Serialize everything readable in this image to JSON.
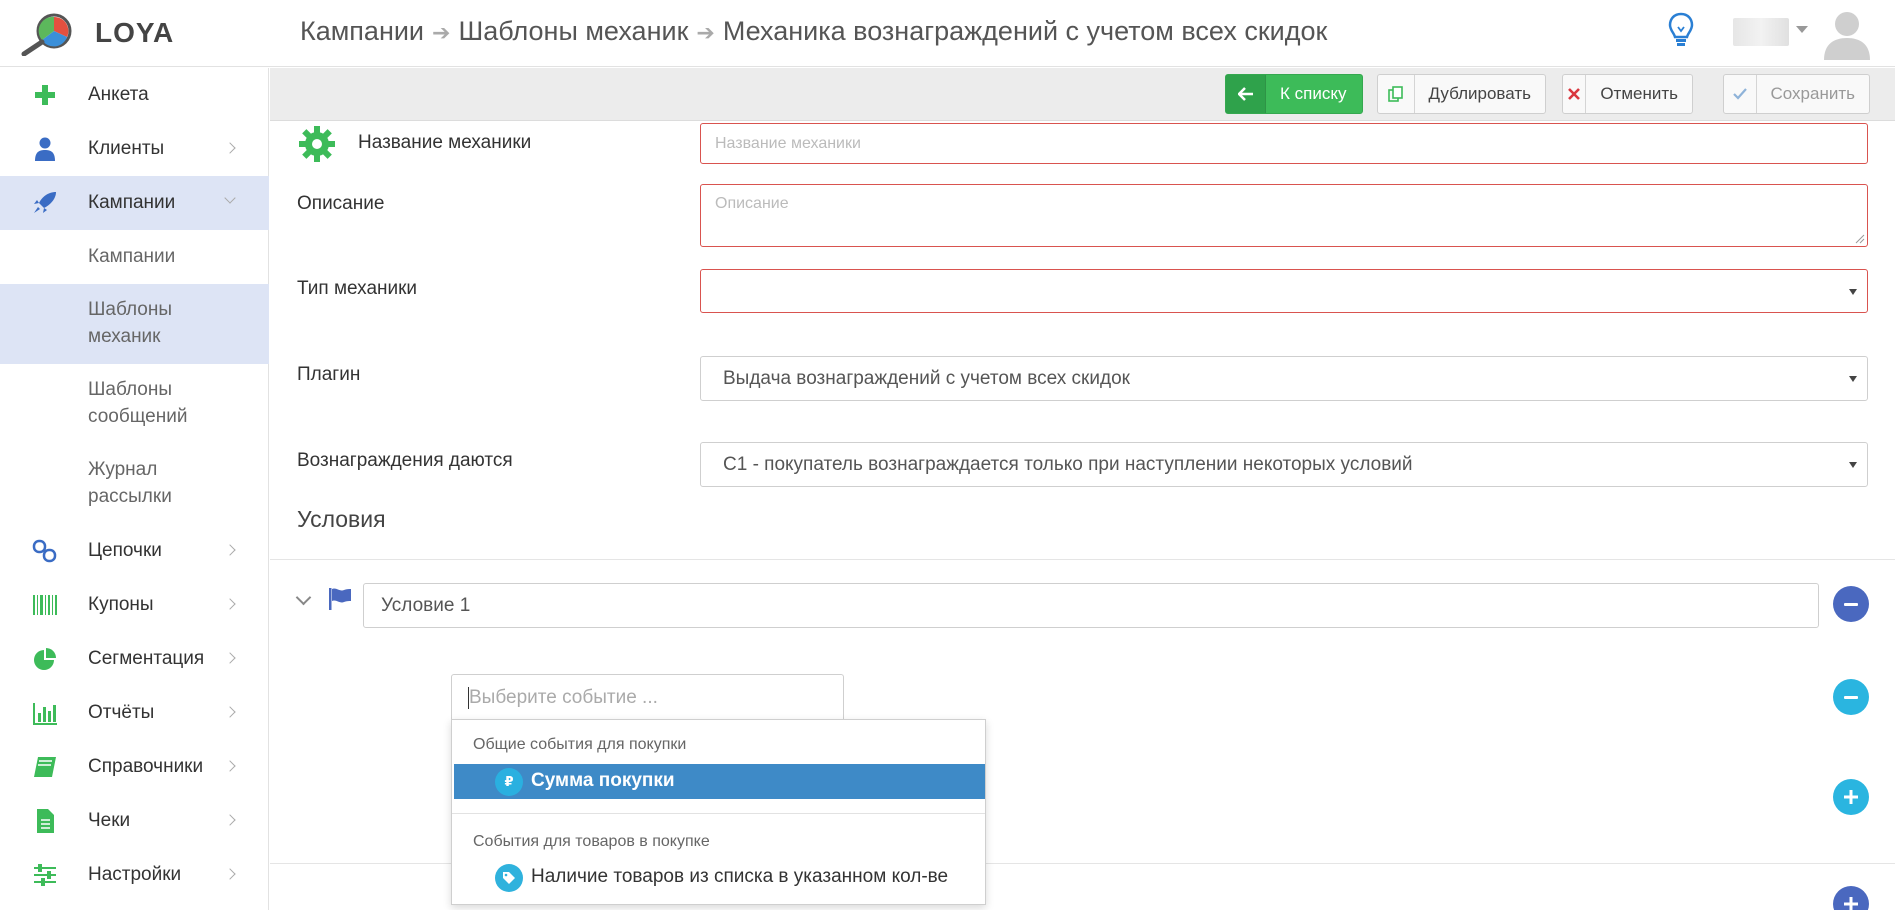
{
  "app": {
    "name": "LOYA"
  },
  "breadcrumb": [
    "Кампании",
    "Шаблоны механик",
    "Механика вознаграждений с учетом всех скидок"
  ],
  "sidebar": {
    "items": [
      {
        "label": "Анкета",
        "icon": "plus-icon"
      },
      {
        "label": "Клиенты",
        "icon": "user-icon"
      },
      {
        "label": "Кампании",
        "icon": "rocket-icon",
        "active": true
      },
      {
        "label": "Цепочки",
        "icon": "link-icon"
      },
      {
        "label": "Купоны",
        "icon": "barcode-icon"
      },
      {
        "label": "Сегментация",
        "icon": "pie-chart-icon"
      },
      {
        "label": "Отчёты",
        "icon": "bar-chart-icon"
      },
      {
        "label": "Справочники",
        "icon": "book-icon"
      },
      {
        "label": "Чеки",
        "icon": "document-icon"
      },
      {
        "label": "Настройки",
        "icon": "sliders-icon"
      }
    ],
    "subitems": [
      {
        "label": "Кампании"
      },
      {
        "label": "Шаблоны механик",
        "active": true
      },
      {
        "label": "Шаблоны сообщений"
      },
      {
        "label": "Журнал рассылки"
      }
    ]
  },
  "toolbar": {
    "back_label": "К списку",
    "duplicate_label": "Дублировать",
    "cancel_label": "Отменить",
    "save_label": "Сохранить"
  },
  "form": {
    "name_label": "Название механики",
    "name_placeholder": "Название механики",
    "description_label": "Описание",
    "description_placeholder": "Описание",
    "type_label": "Тип механики",
    "type_value": "",
    "plugin_label": "Плагин",
    "plugin_value": "Выдача вознаграждений с учетом всех скидок",
    "rewards_label": "Вознаграждения даются",
    "rewards_value": "С1 - покупатель вознаграждается только при наступлении некоторых условий"
  },
  "conditions": {
    "title": "Условия",
    "condition_name": "Условие 1",
    "event_placeholder": "Выберите событие ...",
    "dropdown": {
      "group1": "Общие события для покупки",
      "item1": "Сумма покупки",
      "item1_icon_glyph": "₽",
      "group2": "События для товаров в покупке",
      "item2": "Наличие товаров из списка в указанном кол-ве"
    }
  },
  "colors": {
    "accent_green": "#3dbb59",
    "error_red": "#d9534f",
    "navy": "#4a68bf",
    "cyan": "#2ab5e0",
    "selected_blue": "#3e8ac7",
    "sidebar_active": "#dde4f5"
  }
}
